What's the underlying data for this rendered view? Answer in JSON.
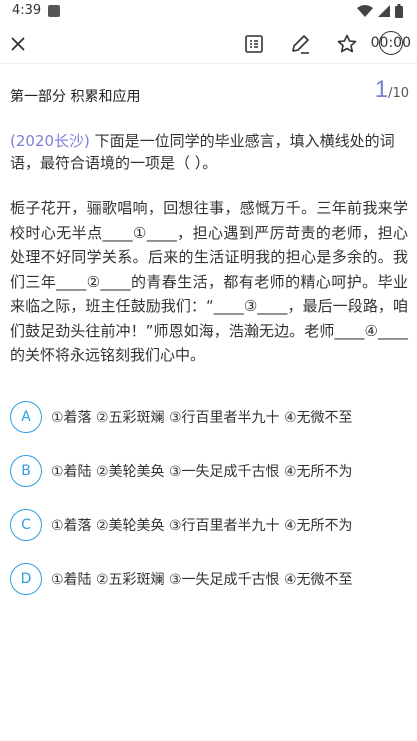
{
  "status_bar": {
    "time": "4:39"
  },
  "toolbar": {
    "timer": "00:00"
  },
  "section": {
    "title": "第一部分 积累和应用",
    "progress_current": "1",
    "progress_total": "/10"
  },
  "question": {
    "source": "(2020长沙)",
    "prompt": "下面是一位同学的毕业感言，填入横线处的词语，最符合语境的一项是（ ）。"
  },
  "passage": "栀子花开，骊歌唱响，回想往事，感慨万千。三年前我来学校时心无半点____①____，担心遇到严厉苛责的老师，担心处理不好同学关系。后来的生活证明我的担心是多余的。我们三年____②____的青春生活，都有老师的精心呵护。毕业来临之际，班主任鼓励我们：“____③____，最后一段路，咱们鼓足劲头往前冲！”师恩如海，浩瀚无边。老师____④____的关怀将永远铭刻我们心中。",
  "options": [
    {
      "letter": "A",
      "text": "①着落 ②五彩斑斓 ③行百里者半九十 ④无微不至"
    },
    {
      "letter": "B",
      "text": "①着陆 ②美轮美奂 ③一失足成千古恨 ④无所不为"
    },
    {
      "letter": "C",
      "text": "①着落 ②美轮美奂 ③行百里者半九十 ④无所不为"
    },
    {
      "letter": "D",
      "text": "①着陆 ②五彩斑斓 ③一失足成千古恨 ④无微不至"
    }
  ],
  "colors": {
    "accent": "#7b7fd8",
    "option_border": "#2f9fe0"
  },
  "icons": [
    "close-icon",
    "answer-sheet-icon",
    "edit-icon",
    "star-icon",
    "timer-icon",
    "wifi-icon",
    "signal-icon",
    "battery-icon"
  ]
}
